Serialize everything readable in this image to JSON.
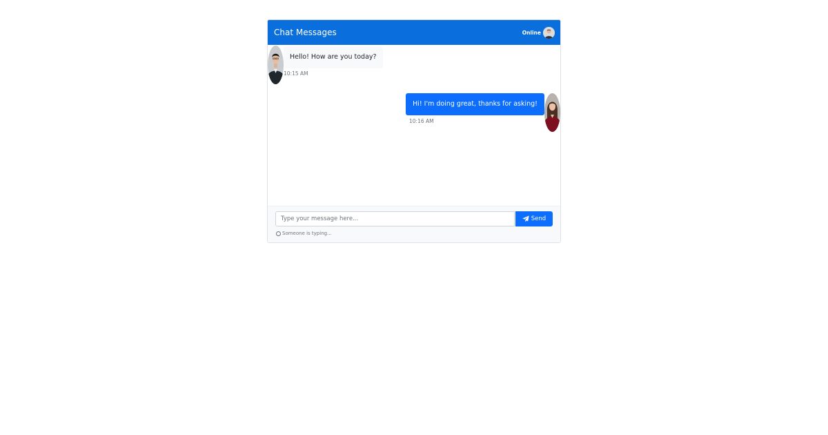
{
  "header": {
    "title": "Chat Messages",
    "status": "Online",
    "avatar_icon": "user-avatar-icon"
  },
  "messages": [
    {
      "sender": "incoming",
      "text": "Hello! How are you today?",
      "time": "10:15 AM",
      "avatar_icon": "man-avatar-icon"
    },
    {
      "sender": "outgoing",
      "text": "Hi! I'm doing great, thanks for asking!",
      "time": "10:16 AM",
      "avatar_icon": "woman-avatar-icon"
    }
  ],
  "composer": {
    "placeholder": "Type your message here...",
    "value": "",
    "send_label": "Send",
    "send_icon": "paper-plane-icon",
    "typing_text": "Someone is typing...",
    "typing_icon": "spinner-icon"
  },
  "colors": {
    "accent": "#0d6efd",
    "header": "#0a6fdc",
    "incoming_bubble": "#f8f9fa",
    "outgoing_bubble": "#0d6efd",
    "muted_text": "#6c757d"
  }
}
